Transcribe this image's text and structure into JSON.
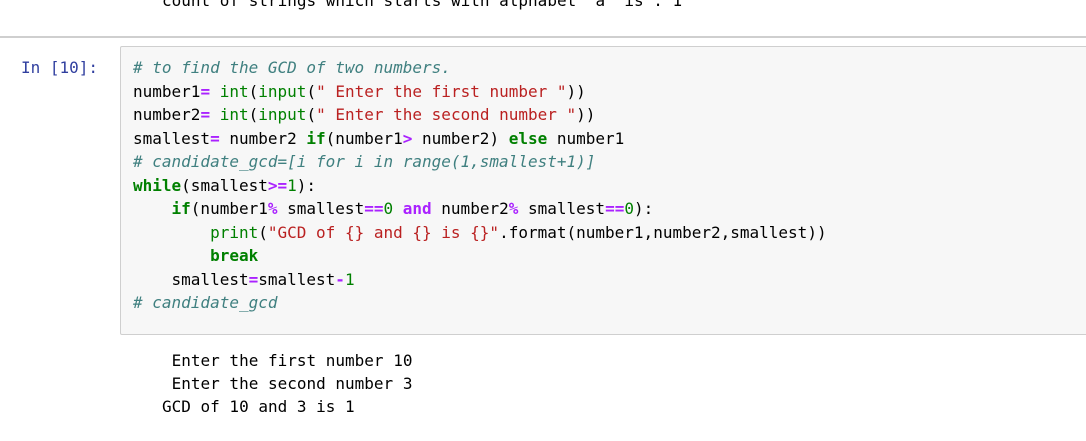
{
  "previous_output": {
    "line": "count of strings which starts with alphabet 'a' is : 1"
  },
  "cell": {
    "prompt": "In [10]:",
    "lines": [
      {
        "tokens": [
          {
            "t": "# to find the GCD of two numbers.",
            "c": "cm"
          }
        ]
      },
      {
        "tokens": [
          {
            "t": "number1",
            "c": ""
          },
          {
            "t": "=",
            "c": "op"
          },
          {
            "t": " ",
            "c": ""
          },
          {
            "t": "int",
            "c": "bi"
          },
          {
            "t": "(",
            "c": ""
          },
          {
            "t": "input",
            "c": "bi"
          },
          {
            "t": "(",
            "c": ""
          },
          {
            "t": "\" Enter the first number \"",
            "c": "st"
          },
          {
            "t": "))",
            "c": ""
          }
        ]
      },
      {
        "tokens": [
          {
            "t": "number2",
            "c": ""
          },
          {
            "t": "=",
            "c": "op"
          },
          {
            "t": " ",
            "c": ""
          },
          {
            "t": "int",
            "c": "bi"
          },
          {
            "t": "(",
            "c": ""
          },
          {
            "t": "input",
            "c": "bi"
          },
          {
            "t": "(",
            "c": ""
          },
          {
            "t": "\" Enter the second number \"",
            "c": "st"
          },
          {
            "t": "))",
            "c": ""
          }
        ]
      },
      {
        "tokens": [
          {
            "t": "smallest",
            "c": ""
          },
          {
            "t": "=",
            "c": "op"
          },
          {
            "t": " number2 ",
            "c": ""
          },
          {
            "t": "if",
            "c": "kw"
          },
          {
            "t": "(number1",
            "c": ""
          },
          {
            "t": ">",
            "c": "op"
          },
          {
            "t": " number2) ",
            "c": ""
          },
          {
            "t": "else",
            "c": "kw"
          },
          {
            "t": " number1",
            "c": ""
          }
        ]
      },
      {
        "tokens": [
          {
            "t": "# candidate_gcd=[i for i in range(1,smallest+1)]",
            "c": "cm"
          }
        ]
      },
      {
        "tokens": [
          {
            "t": "while",
            "c": "kw"
          },
          {
            "t": "(smallest",
            "c": ""
          },
          {
            "t": ">=",
            "c": "op"
          },
          {
            "t": "1",
            "c": "nm"
          },
          {
            "t": "):",
            "c": ""
          }
        ]
      },
      {
        "tokens": [
          {
            "t": "    ",
            "c": ""
          },
          {
            "t": "if",
            "c": "kw"
          },
          {
            "t": "(number1",
            "c": ""
          },
          {
            "t": "%",
            "c": "op"
          },
          {
            "t": " smallest",
            "c": ""
          },
          {
            "t": "==",
            "c": "op"
          },
          {
            "t": "0",
            "c": "nm"
          },
          {
            "t": " ",
            "c": ""
          },
          {
            "t": "and",
            "c": "op"
          },
          {
            "t": " number2",
            "c": ""
          },
          {
            "t": "%",
            "c": "op"
          },
          {
            "t": " smallest",
            "c": ""
          },
          {
            "t": "==",
            "c": "op"
          },
          {
            "t": "0",
            "c": "nm"
          },
          {
            "t": "):",
            "c": ""
          }
        ]
      },
      {
        "tokens": [
          {
            "t": "        ",
            "c": ""
          },
          {
            "t": "print",
            "c": "bi"
          },
          {
            "t": "(",
            "c": ""
          },
          {
            "t": "\"GCD of {} and {} is {}\"",
            "c": "st"
          },
          {
            "t": ".format(number1,number2,smallest))",
            "c": ""
          }
        ]
      },
      {
        "tokens": [
          {
            "t": "        ",
            "c": ""
          },
          {
            "t": "break",
            "c": "kw"
          }
        ]
      },
      {
        "tokens": [
          {
            "t": "    smallest",
            "c": ""
          },
          {
            "t": "=",
            "c": "op"
          },
          {
            "t": "smallest",
            "c": ""
          },
          {
            "t": "-",
            "c": "op"
          },
          {
            "t": "1",
            "c": "nm"
          }
        ]
      },
      {
        "tokens": [
          {
            "t": "# candidate_gcd",
            "c": "cm"
          }
        ]
      }
    ]
  },
  "output": {
    "lines": [
      " Enter the first number 10",
      " Enter the second number 3",
      "GCD of 10 and 3 is 1"
    ]
  },
  "colors": {
    "prompt": "#303f9f",
    "comment": "#408080",
    "keyword": "#008000",
    "operator": "#aa22ff",
    "string": "#ba2121",
    "cell_background": "#f7f7f7",
    "cell_border": "#cfcfcf"
  }
}
